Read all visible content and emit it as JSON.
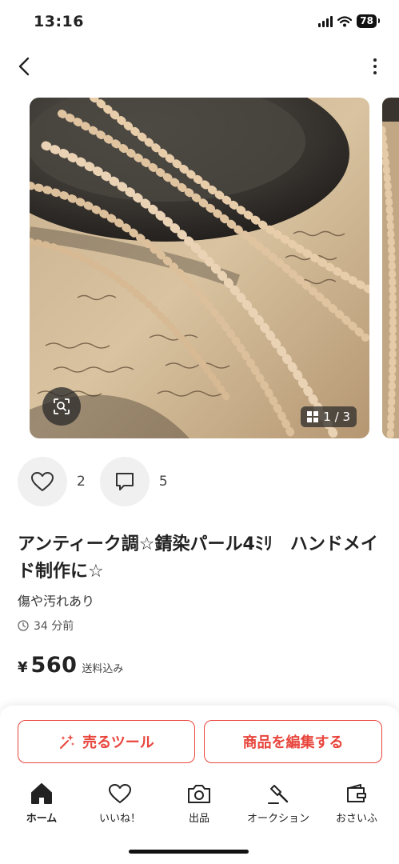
{
  "status_bar": {
    "time": "13:16",
    "battery": "78"
  },
  "product": {
    "image_counter": "1 / 3",
    "likes": "2",
    "comments": "5",
    "title": "アンティーク調☆錆染パール4ﾐﾘ　ハンドメイド制作に☆",
    "condition": "傷や汚れあり",
    "posted": "34 分前",
    "currency": "¥",
    "price": "560",
    "shipping": "送料込み"
  },
  "buttons": {
    "sell_tool": "売るツール",
    "edit": "商品を編集する"
  },
  "tabbar": [
    {
      "label": "ホーム",
      "icon": "home-icon"
    },
    {
      "label": "いいね！",
      "icon": "heart-icon"
    },
    {
      "label": "出品",
      "icon": "camera-icon"
    },
    {
      "label": "オークション",
      "icon": "gavel-icon"
    },
    {
      "label": "おさいふ",
      "icon": "wallet-icon"
    }
  ],
  "colors": {
    "accent": "#e8453c",
    "text": "#222222",
    "panel": "#f0f0f0"
  }
}
